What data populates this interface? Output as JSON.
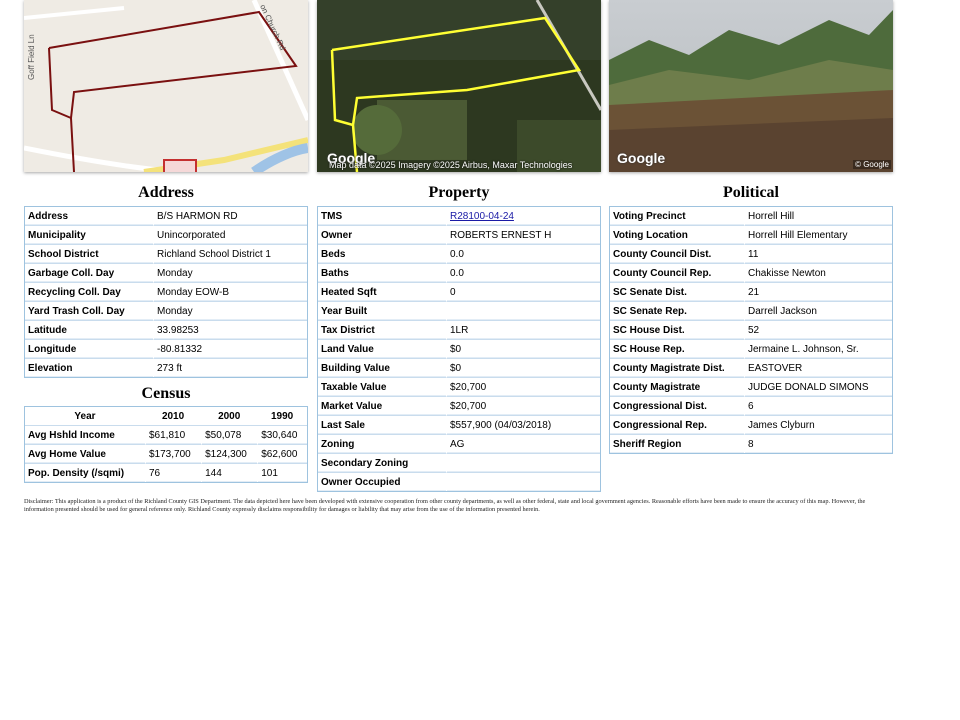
{
  "map": {
    "road1": "Goff Field Ln",
    "road2": "on Church Rd"
  },
  "aerial": {
    "logo": "Google",
    "attribution": "Map data ©2025 Imagery ©2025 Airbus, Maxar Technologies"
  },
  "street": {
    "logo": "Google",
    "copyright": "© Google"
  },
  "address": {
    "title": "Address",
    "rows": [
      {
        "label": "Address",
        "value": "B/S HARMON RD"
      },
      {
        "label": "Municipality",
        "value": "Unincorporated"
      },
      {
        "label": "School District",
        "value": "Richland School District 1"
      },
      {
        "label": "Garbage Coll. Day",
        "value": "Monday"
      },
      {
        "label": "Recycling Coll. Day",
        "value": "Monday EOW-B"
      },
      {
        "label": "Yard Trash Coll. Day",
        "value": "Monday"
      },
      {
        "label": "Latitude",
        "value": "33.98253"
      },
      {
        "label": "Longitude",
        "value": "-80.81332"
      },
      {
        "label": "Elevation",
        "value": "273 ft"
      }
    ]
  },
  "census": {
    "title": "Census",
    "headers": [
      "Year",
      "2010",
      "2000",
      "1990"
    ],
    "rows": [
      {
        "label": "Avg Hshld Income",
        "v2010": "$61,810",
        "v2000": "$50,078",
        "v1990": "$30,640"
      },
      {
        "label": "Avg Home Value",
        "v2010": "$173,700",
        "v2000": "$124,300",
        "v1990": "$62,600"
      },
      {
        "label": "Pop. Density (/sqmi)",
        "v2010": "76",
        "v2000": "144",
        "v1990": "101"
      }
    ]
  },
  "property": {
    "title": "Property",
    "rows": [
      {
        "label": "TMS",
        "value": "R28100-04-24"
      },
      {
        "label": "Owner",
        "value": "ROBERTS ERNEST H"
      },
      {
        "label": "Beds",
        "value": "0.0"
      },
      {
        "label": "Baths",
        "value": "0.0"
      },
      {
        "label": "Heated Sqft",
        "value": "0"
      },
      {
        "label": "Year Built",
        "value": ""
      },
      {
        "label": "Tax District",
        "value": "1LR"
      },
      {
        "label": "Land Value",
        "value": "$0"
      },
      {
        "label": "Building Value",
        "value": "$0"
      },
      {
        "label": "Taxable Value",
        "value": "$20,700"
      },
      {
        "label": "Market Value",
        "value": "$20,700"
      },
      {
        "label": "Last Sale",
        "value": "$557,900 (04/03/2018)"
      },
      {
        "label": "Zoning",
        "value": "AG"
      },
      {
        "label": "Secondary Zoning",
        "value": ""
      },
      {
        "label": "Owner Occupied",
        "value": ""
      }
    ]
  },
  "political": {
    "title": "Political",
    "rows": [
      {
        "label": "Voting Precinct",
        "value": "Horrell Hill"
      },
      {
        "label": "Voting Location",
        "value": "Horrell Hill Elementary"
      },
      {
        "label": "County Council Dist.",
        "value": "11"
      },
      {
        "label": "County Council Rep.",
        "value": "Chakisse Newton"
      },
      {
        "label": "SC Senate Dist.",
        "value": "21"
      },
      {
        "label": "SC Senate Rep.",
        "value": "Darrell Jackson"
      },
      {
        "label": "SC House Dist.",
        "value": "52"
      },
      {
        "label": "SC House Rep.",
        "value": "Jermaine L. Johnson, Sr."
      },
      {
        "label": "County Magistrate Dist.",
        "value": "EASTOVER"
      },
      {
        "label": "County Magistrate",
        "value": "JUDGE DONALD SIMONS"
      },
      {
        "label": "Congressional Dist.",
        "value": "6"
      },
      {
        "label": "Congressional Rep.",
        "value": "James Clyburn"
      },
      {
        "label": "Sheriff Region",
        "value": "8"
      }
    ]
  },
  "disclaimer": "Disclaimer: This application is a product of the Richland County GIS Department. The data depicted here have been developed with extensive cooperation from other county departments, as well as other federal, state and local government agencies. Reasonable efforts have been made to ensure the accuracy of this map. However, the information presented should be used for general reference only. Richland County expressly disclaims responsibility for damages or liability that may arise from the use of the information presented herein."
}
